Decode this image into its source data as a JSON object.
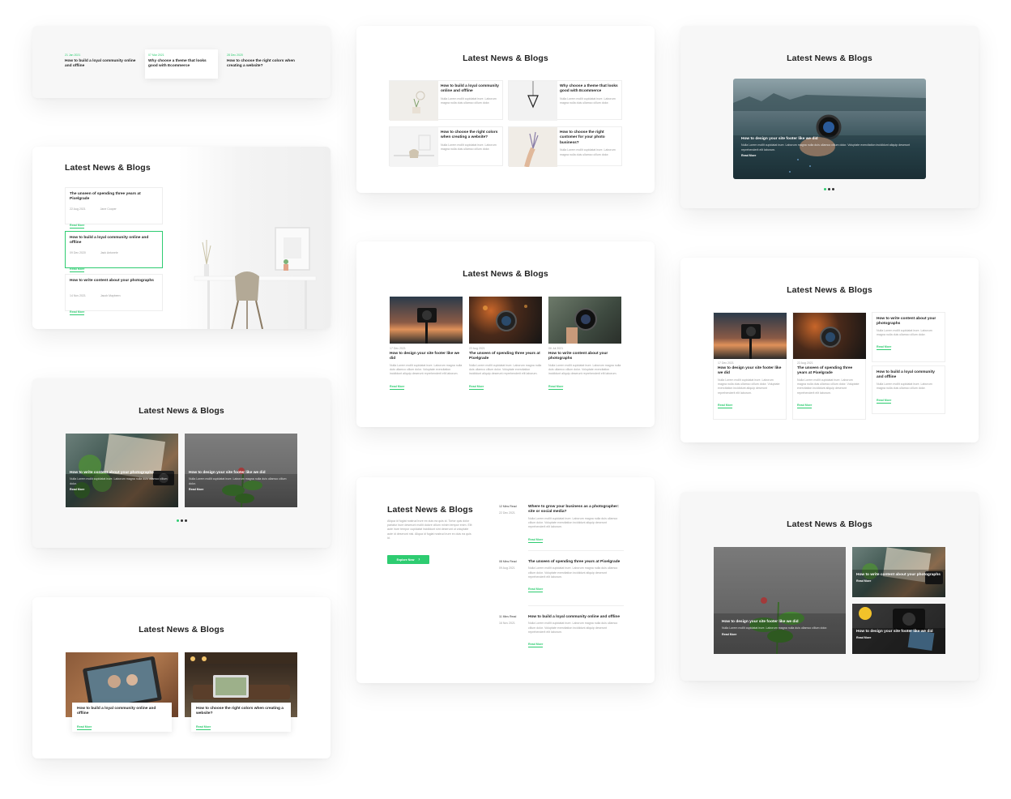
{
  "heading": "Latest News & Blogs",
  "read_more": "Read More",
  "lorem_short": "Nulla Lorem mollit cupidatat irure. Laborum magna nulla duis ullamco cillum dolor.",
  "lorem_long": "Nulla Lorem mollit cupidatat irure. Laborum magna nulla duis ullamco cillum dolor. Voluptate exercitation incididunt aliquip deserunt reprehenderit elit laborum.",
  "c1": {
    "items": [
      {
        "date": "21 Jan 2021",
        "title": "How to build a loyal community online and offline"
      },
      {
        "date": "07 Mar 2021",
        "title": "Why choose a theme that looks good with Ecommerce"
      },
      {
        "date": "28 Dec 2020",
        "title": "How to choose the right colors when creating a website?"
      }
    ]
  },
  "c2": {
    "items": [
      {
        "title": "The unseen of spending three years at Pixelgrade",
        "date": "22 Aug 2021",
        "author": "Jane Cooper"
      },
      {
        "title": "How to build a loyal community online and offline",
        "date": "09 Dec 2020",
        "author": "Jack Antonele"
      },
      {
        "title": "How to write content about your photographs",
        "date": "14 Nov 2021",
        "author": "Jacob Maybeen"
      }
    ]
  },
  "c3": {
    "items": [
      {
        "title": "How to write content about your photographs"
      },
      {
        "title": "How to design your site footer like we did"
      }
    ]
  },
  "c4": {
    "items": [
      {
        "title": "How to build a loyal community online and offline"
      },
      {
        "title": "How to choose the right colors when creating a website?"
      }
    ]
  },
  "c5": {
    "items": [
      {
        "title": "How to build a loyal community online and offline"
      },
      {
        "title": "Why choose a theme that looks good with Ecommerce"
      },
      {
        "title": "How to choose the right colors when creating a website?"
      },
      {
        "title": "How to choose the right customer for your photo business?"
      }
    ]
  },
  "c6": {
    "items": [
      {
        "date": "17 Dec 2021",
        "title": "How to design your site footer like we did"
      },
      {
        "date": "22 Aug 2021",
        "title": "The unseen of spending three years at Pixelgrade"
      },
      {
        "date": "06 Jul 2021",
        "title": "How to write content about your photographs"
      }
    ]
  },
  "c7": {
    "intro": "Aliqua id fugiat nostrud irure ex duis ea quis id. Tortor quis dolor pariatur irure deserunt mollit dolore cillum minim tempor enim. Elit aute irure tempor cupidatat incididunt sint deserunt ut voluptate aute id deserunt nisi. Aliqua id fugiat nostrud irure ex duis ea quis id.",
    "button": "Explore Now",
    "items": [
      {
        "read": "12 Mins Read",
        "date": "22 Dec 2021",
        "title": "Where to grow your business as a photographer: site or social media?"
      },
      {
        "read": "08 Mins Read",
        "date": "09 Aug 2021",
        "title": "The unseen of spending three years at Pixelgrade"
      },
      {
        "read": "11 Mins Read",
        "date": "16 Nov 2021",
        "title": "How to build a loyal community online and offline"
      }
    ]
  },
  "c8": {
    "title": "How to design your site footer like we did"
  },
  "c9": {
    "items": [
      {
        "date": "17 Dec 2021",
        "title": "How to design your site footer like we did"
      },
      {
        "date": "22 Aug 2021",
        "title": "The unseen of spending three years at Pixelgrade"
      },
      {
        "title": "How to write content about your photographs"
      },
      {
        "title": "How to build a loyal community and offline"
      }
    ]
  },
  "c10": {
    "items": [
      {
        "title": "How to design your site footer like we did"
      },
      {
        "title": "How to write content about your photographs"
      },
      {
        "title": "How to design your site footer like we did"
      }
    ]
  },
  "colors": {
    "accent": "#2ecc71"
  }
}
